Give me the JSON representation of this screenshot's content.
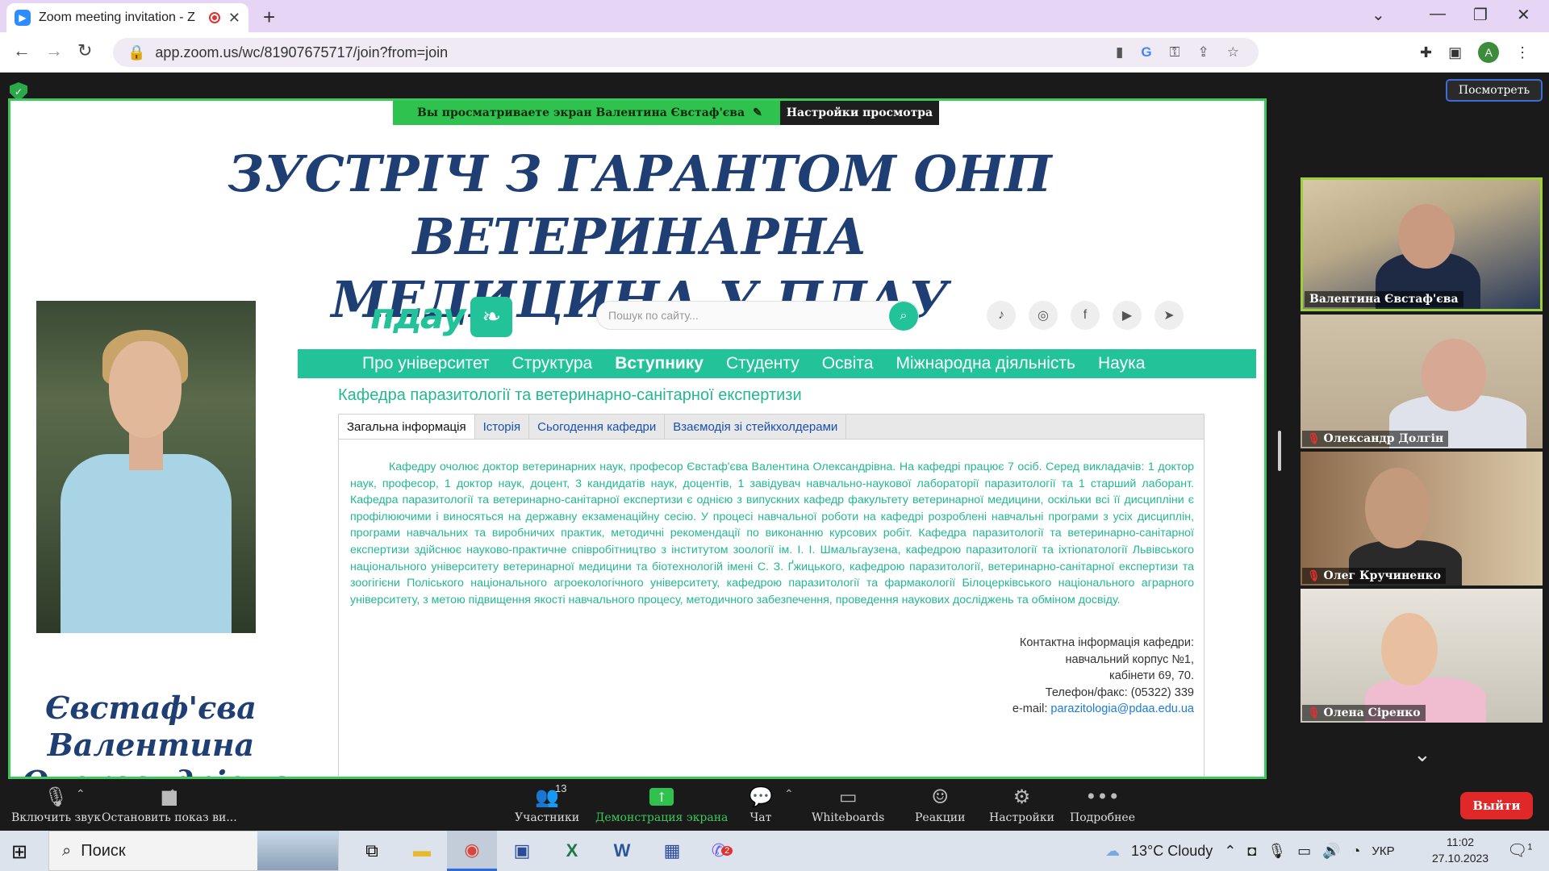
{
  "browser": {
    "tab_title": "Zoom meeting invitation - Z",
    "url": "app.zoom.us/wc/81907675717/join?from=join",
    "profile_initial": "A"
  },
  "zoom": {
    "view_button": "Посмотреть",
    "banner_text": "Вы просматриваете экран  Валентина Євстаф'єва",
    "banner_settings": "Настройки просмотра"
  },
  "slide": {
    "title_line1": "ЗУСТРІЧ З ГАРАНТОМ ОНП ВЕТЕРИНАРНА",
    "title_line2": "МЕДИЦИНА У ПДАУ",
    "name_line1": "Євстаф'єва",
    "name_line2": "Валентина",
    "name_line3": "Олександрівна"
  },
  "site": {
    "logo_text": "пдау",
    "search_placeholder": "Пошук по сайту...",
    "menu": [
      "Про університет",
      "Структура",
      "Вступнику",
      "Студенту",
      "Освіта",
      "Міжнародна діяльність",
      "Наука"
    ],
    "dept_title": "Кафедра паразитології та ветеринарно-санітарної експертизи",
    "tabs": [
      "Загальна інформація",
      "Історія",
      "Сьогодення кафедри",
      "Взаємодія зі стейкхолдерами"
    ],
    "body_text": "Кафедру очолює доктор ветеринарних наук, професор Євстаф'єва Валентина Олександрівна. На кафедрі працює 7 осіб. Серед викладачів: 1 доктор наук, професор, 1 доктор наук, доцент, 3 кандидатів наук, доцентів, 1 завідувач навчально-наукової лабораторії паразитології та 1 старший лаборант. Кафедра паразитології та ветеринарно-санітарної експертизи є однією з випускних кафедр факультету ветеринарної медицини, оскільки всі її дисципліни є профілюючими і виносяться на державну екзаменаційну сесію. У процесі навчальної роботи на кафедрі розроблені навчальні програми з усіх дисциплін, програми навчальних та виробничих практик, методичні рекомендації по виконанню курсових робіт.  Кафедра паразитології та ветеринарно-санітарної експертизи здійснює науково-практичне співробітництво з інститутом зоології ім. І. І. Шмальгаузена, кафедрою паразитології та іхтіопатології Львівського національного університету ветеринарної медицини та біотехнологій імені С. З. Ґжицького, кафедрою паразитології, ветеринарно-санітарної експертизи та зоогігієни Поліського національного агроекологічного університету, кафедрою паразитології та фармакології Білоцерківського національного аграрного університету, з метою підвищення якості навчального процесу, методичного забезпечення, проведення наукових досліджень та обміном досвіду.",
    "contacts": {
      "line1": "Контактна інформація кафедри:",
      "line2": "навчальний корпус №1,",
      "line3": "кабінети 69, 70.",
      "line4": "Телефон/факс: (05322) 339",
      "email_label": "e-mail:",
      "email": "parazitologia@pdaa.edu.ua"
    }
  },
  "participants": [
    {
      "name": "Валентина Євстаф'єва",
      "muted": false
    },
    {
      "name": "Олександр Долгін",
      "muted": true
    },
    {
      "name": "Олег Кручиненко",
      "muted": true
    },
    {
      "name": "Олена Сіренко",
      "muted": true
    }
  ],
  "toolbar": {
    "unmute": "Включить звук",
    "stop_video": "Остановить показ ви...",
    "participants": "Участники",
    "participants_count": "13",
    "share": "Демонстрация экрана",
    "chat": "Чат",
    "whiteboards": "Whiteboards",
    "reactions": "Реакции",
    "settings": "Настройки",
    "more": "Подробнее",
    "leave": "Выйти"
  },
  "taskbar": {
    "search": "Поиск",
    "weather": "13°C  Cloudy",
    "lang": "УКР",
    "time": "11:02",
    "date": "27.10.2023",
    "viber_badge": "2",
    "notif_count": "1"
  },
  "colors": {
    "accent_green": "#23c39a",
    "share_border": "#3cc85a",
    "slide_blue": "#1f3f74",
    "leave_red": "#e02828"
  }
}
